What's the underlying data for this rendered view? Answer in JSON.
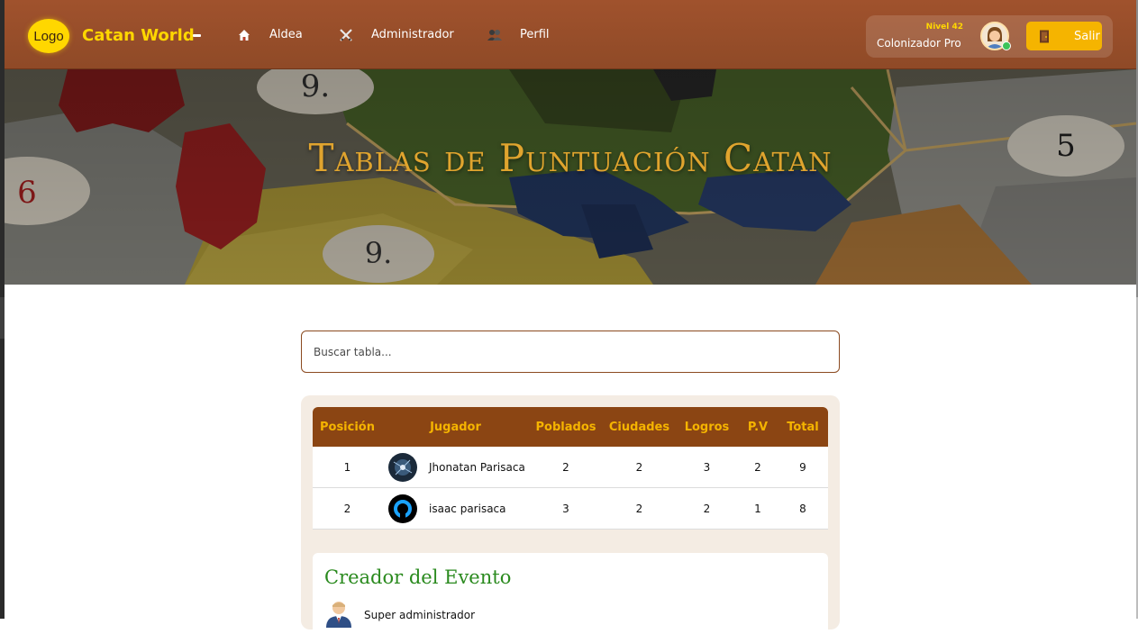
{
  "brand": {
    "logo_text": "Logo",
    "name": "Catan World"
  },
  "nav": {
    "items": [
      {
        "label": "Aldea",
        "icon": "house-icon"
      },
      {
        "label": "Administrador",
        "icon": "crossed-swords-icon"
      },
      {
        "label": "Perfil",
        "icon": "people-icon"
      }
    ]
  },
  "user": {
    "level": "Nivel 42",
    "rank": "Colonizador Pro",
    "avatar_icon": "user-avatar-icon",
    "logout_label": "Salir",
    "logout_icon": "door-icon"
  },
  "hero": {
    "title": "Tablas de Puntuación Catan"
  },
  "search": {
    "placeholder": "Buscar tabla..."
  },
  "table": {
    "headers": [
      "Posición",
      "Jugador",
      "Poblados",
      "Ciudades",
      "Logros",
      "P.V",
      "Total"
    ],
    "rows": [
      {
        "position": "1",
        "player": "Jhonatan Parisaca",
        "poblados": "2",
        "ciudades": "2",
        "logros": "3",
        "pv": "2",
        "total": "9"
      },
      {
        "position": "2",
        "player": "isaac parisaca",
        "poblados": "3",
        "ciudades": "2",
        "logros": "2",
        "pv": "1",
        "total": "8"
      }
    ]
  },
  "creator": {
    "title": "Creador del Evento",
    "name": "Super administrador"
  },
  "colors": {
    "navbar": "#a0522d",
    "accent_gold": "#ffd700",
    "button_yellow": "#f5b400",
    "table_header": "#8b4513",
    "creator_green": "#2a8a1e"
  }
}
